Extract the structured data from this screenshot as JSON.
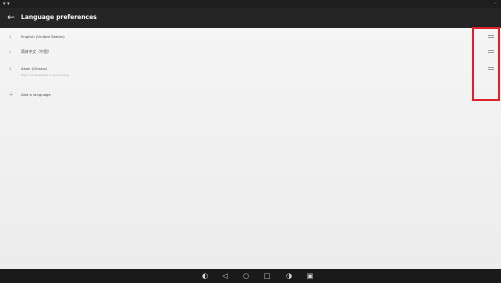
{
  "status_bar": {
    "left_text": "▾ ▾",
    "right_text": "◦"
  },
  "app_bar": {
    "back_glyph": "←",
    "title": "Language preferences"
  },
  "languages": [
    {
      "index": "1",
      "label": "English (United States)",
      "sublabel": ""
    },
    {
      "index": "2",
      "label": "简体中文（中国）",
      "sublabel": ""
    },
    {
      "index": "3",
      "label": "Akan (Ghana)",
      "sublabel": "Help not available in some apps"
    }
  ],
  "add_language": {
    "plus_glyph": "+",
    "label": "Add a language"
  },
  "nav_bar": {
    "icons": [
      {
        "name": "camera-icon",
        "glyph": "◐"
      },
      {
        "name": "back-icon",
        "glyph": "◁"
      },
      {
        "name": "home-icon",
        "glyph": "○"
      },
      {
        "name": "recents-icon",
        "glyph": "□"
      },
      {
        "name": "screenshot-icon",
        "glyph": "◑"
      },
      {
        "name": "multiwindow-icon",
        "glyph": "▣"
      }
    ]
  },
  "colors": {
    "highlight": "#e0202a",
    "app_bar": "#252525"
  }
}
